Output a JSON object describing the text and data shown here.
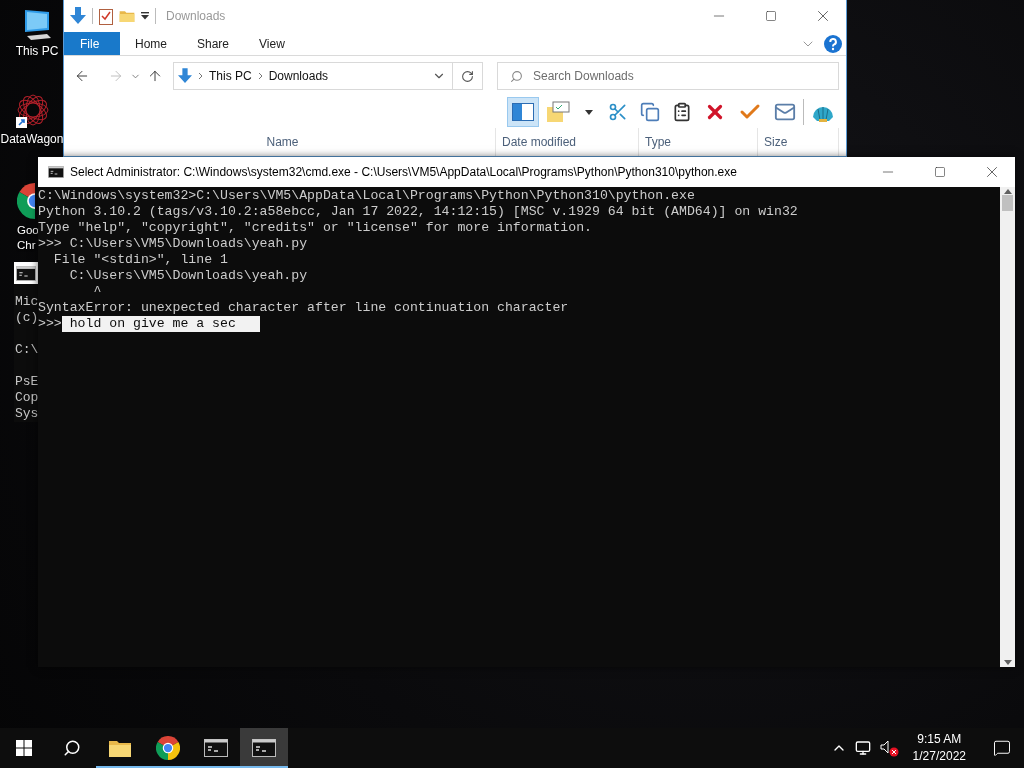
{
  "desktop_icons": [
    {
      "kind": "pc",
      "lines": [
        "This PC"
      ]
    },
    {
      "kind": "datawagon",
      "lines": [
        "DataWagon"
      ]
    },
    {
      "kind": "chrome",
      "lines": [
        "Goo",
        "Chr"
      ]
    }
  ],
  "background_console": {
    "paragraphs": [
      [
        "Mic",
        "(c)"
      ],
      [
        "C:\\"
      ],
      [
        "PsE",
        "Cop",
        "Sys"
      ]
    ]
  },
  "explorer": {
    "title": "Downloads",
    "ribbon_tabs": [
      {
        "label": "File",
        "kind": "file"
      },
      {
        "label": "Home",
        "kind": "tab"
      },
      {
        "label": "Share",
        "kind": "tab"
      },
      {
        "label": "View",
        "kind": "tab"
      }
    ],
    "breadcrumbs": [
      "This PC",
      "Downloads"
    ],
    "search": {
      "placeholder": "Search Downloads"
    },
    "toolbar": [
      {
        "kind": "preview-pane",
        "selected": true
      },
      {
        "kind": "properties",
        "selected": false
      },
      {
        "kind": "dropdown",
        "selected": false
      },
      {
        "kind": "cut",
        "selected": false
      },
      {
        "kind": "copy",
        "selected": false
      },
      {
        "kind": "paste",
        "selected": false
      },
      {
        "kind": "delete",
        "selected": false
      },
      {
        "kind": "check",
        "selected": false
      },
      {
        "kind": "mail",
        "selected": false
      },
      {
        "kind": "shell",
        "selected": false
      }
    ],
    "columns": [
      "Name",
      "Date modified",
      "Type",
      "Size"
    ]
  },
  "console_window": {
    "title": "Select Administrator: C:\\Windows\\system32\\cmd.exe - C:\\Users\\VM5\\AppData\\Local\\Programs\\Python\\Python310\\python.exe",
    "lines": [
      "C:\\Windows\\system32>C:\\Users\\VM5\\AppData\\Local\\Programs\\Python\\Python310\\python.exe",
      "Python 3.10.2 (tags/v3.10.2:a58ebcc, Jan 17 2022, 14:12:15) [MSC v.1929 64 bit (AMD64)] on win32",
      "Type \"help\", \"copyright\", \"credits\" or \"license\" for more information.",
      ">>> C:\\Users\\VM5\\Downloads\\yeah.py",
      "  File \"<stdin>\", line 1",
      "    C:\\Users\\VM5\\Downloads\\yeah.py",
      "       ^",
      "SyntaxError: unexpected character after line continuation character"
    ],
    "input": {
      "prompt": ">>>",
      "selected_text": "hold on give me a sec"
    }
  },
  "taskbar": {
    "apps": [
      {
        "kind": "explorer",
        "open": true,
        "selected": false
      },
      {
        "kind": "chrome",
        "open": true,
        "selected": false
      },
      {
        "kind": "cmd",
        "open": true,
        "selected": false
      },
      {
        "kind": "cmd",
        "open": true,
        "selected": true
      }
    ],
    "volume_muted": true,
    "clock": {
      "time": "9:15 AM",
      "date": "1/27/2022"
    }
  }
}
